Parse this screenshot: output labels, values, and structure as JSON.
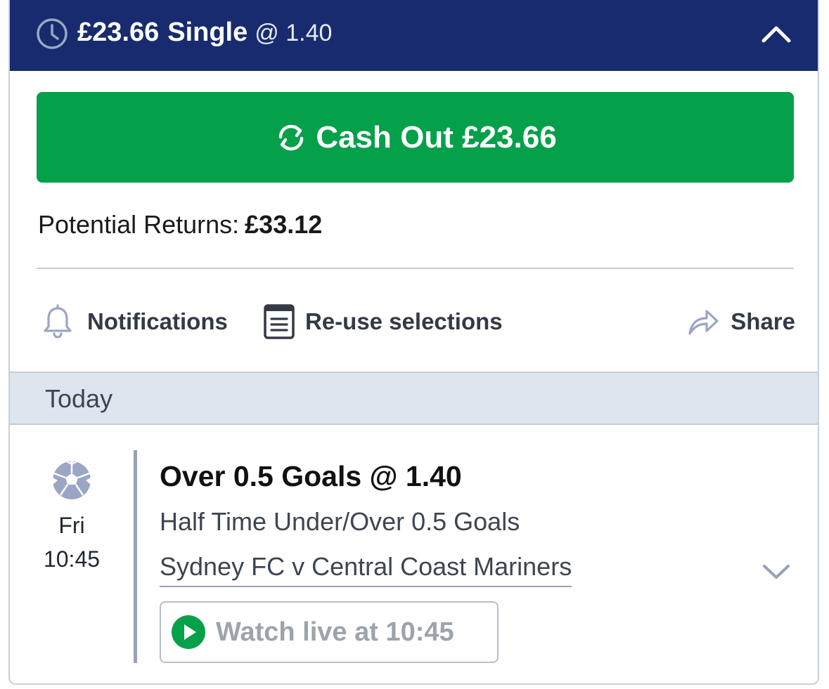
{
  "header": {
    "stake": "£23.66",
    "bet_type": "Single",
    "odds": "@ 1.40",
    "clock_icon": "clock-icon",
    "collapse_icon": "chevron-up-icon"
  },
  "cashout": {
    "label": "Cash Out £23.66",
    "icon": "refresh-icon",
    "color": "#04a04a"
  },
  "returns": {
    "label": "Potential Returns:",
    "amount": "£33.12"
  },
  "actions": {
    "notifications": {
      "label": "Notifications",
      "icon": "bell-icon"
    },
    "reuse": {
      "label": "Re-use selections",
      "icon": "document-list-icon"
    },
    "share": {
      "label": "Share",
      "icon": "share-arrow-icon"
    }
  },
  "section": {
    "date_label": "Today"
  },
  "selection": {
    "sport_icon": "football-icon",
    "day": "Fri",
    "time": "10:45",
    "title": "Over 0.5 Goals @ 1.40",
    "market": "Half Time Under/Over 0.5 Goals",
    "event": "Sydney FC v Central Coast Mariners",
    "expand_icon": "chevron-down-icon",
    "watch_label": "Watch live at 10:45",
    "watch_icon": "play-icon"
  },
  "colors": {
    "header_bg": "#172b6e",
    "accent_green": "#04a04a",
    "section_bg": "#dfe5ee"
  }
}
